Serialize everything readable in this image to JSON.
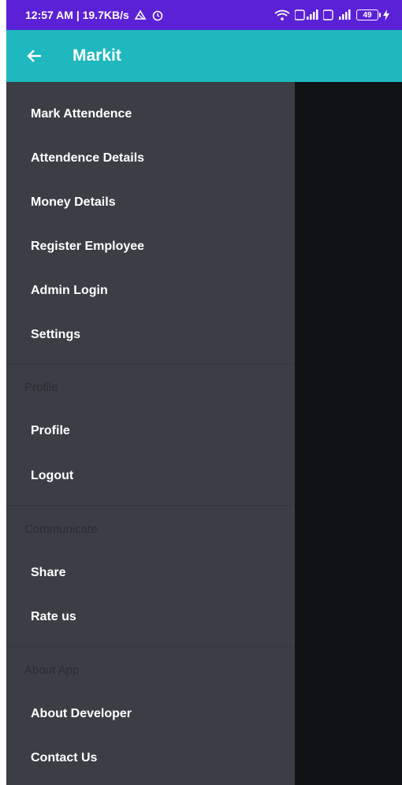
{
  "status_bar": {
    "time_speed": "12:57 AM | 19.7KB/s",
    "battery": "49"
  },
  "toolbar": {
    "title": "Markit"
  },
  "drawer": {
    "main_items": [
      {
        "label": "Mark Attendence"
      },
      {
        "label": "Attendence Details"
      },
      {
        "label": "Money Details"
      },
      {
        "label": "Register Employee"
      },
      {
        "label": "Admin Login"
      },
      {
        "label": "Settings"
      }
    ],
    "profile": {
      "header": "Profile",
      "items": [
        {
          "label": "Profile"
        },
        {
          "label": "Logout"
        }
      ]
    },
    "communicate": {
      "header": "Communicate",
      "items": [
        {
          "label": "Share"
        },
        {
          "label": "Rate us"
        }
      ]
    },
    "about": {
      "header": "About App",
      "items": [
        {
          "label": "About Developer"
        },
        {
          "label": "Contact Us"
        }
      ]
    }
  }
}
